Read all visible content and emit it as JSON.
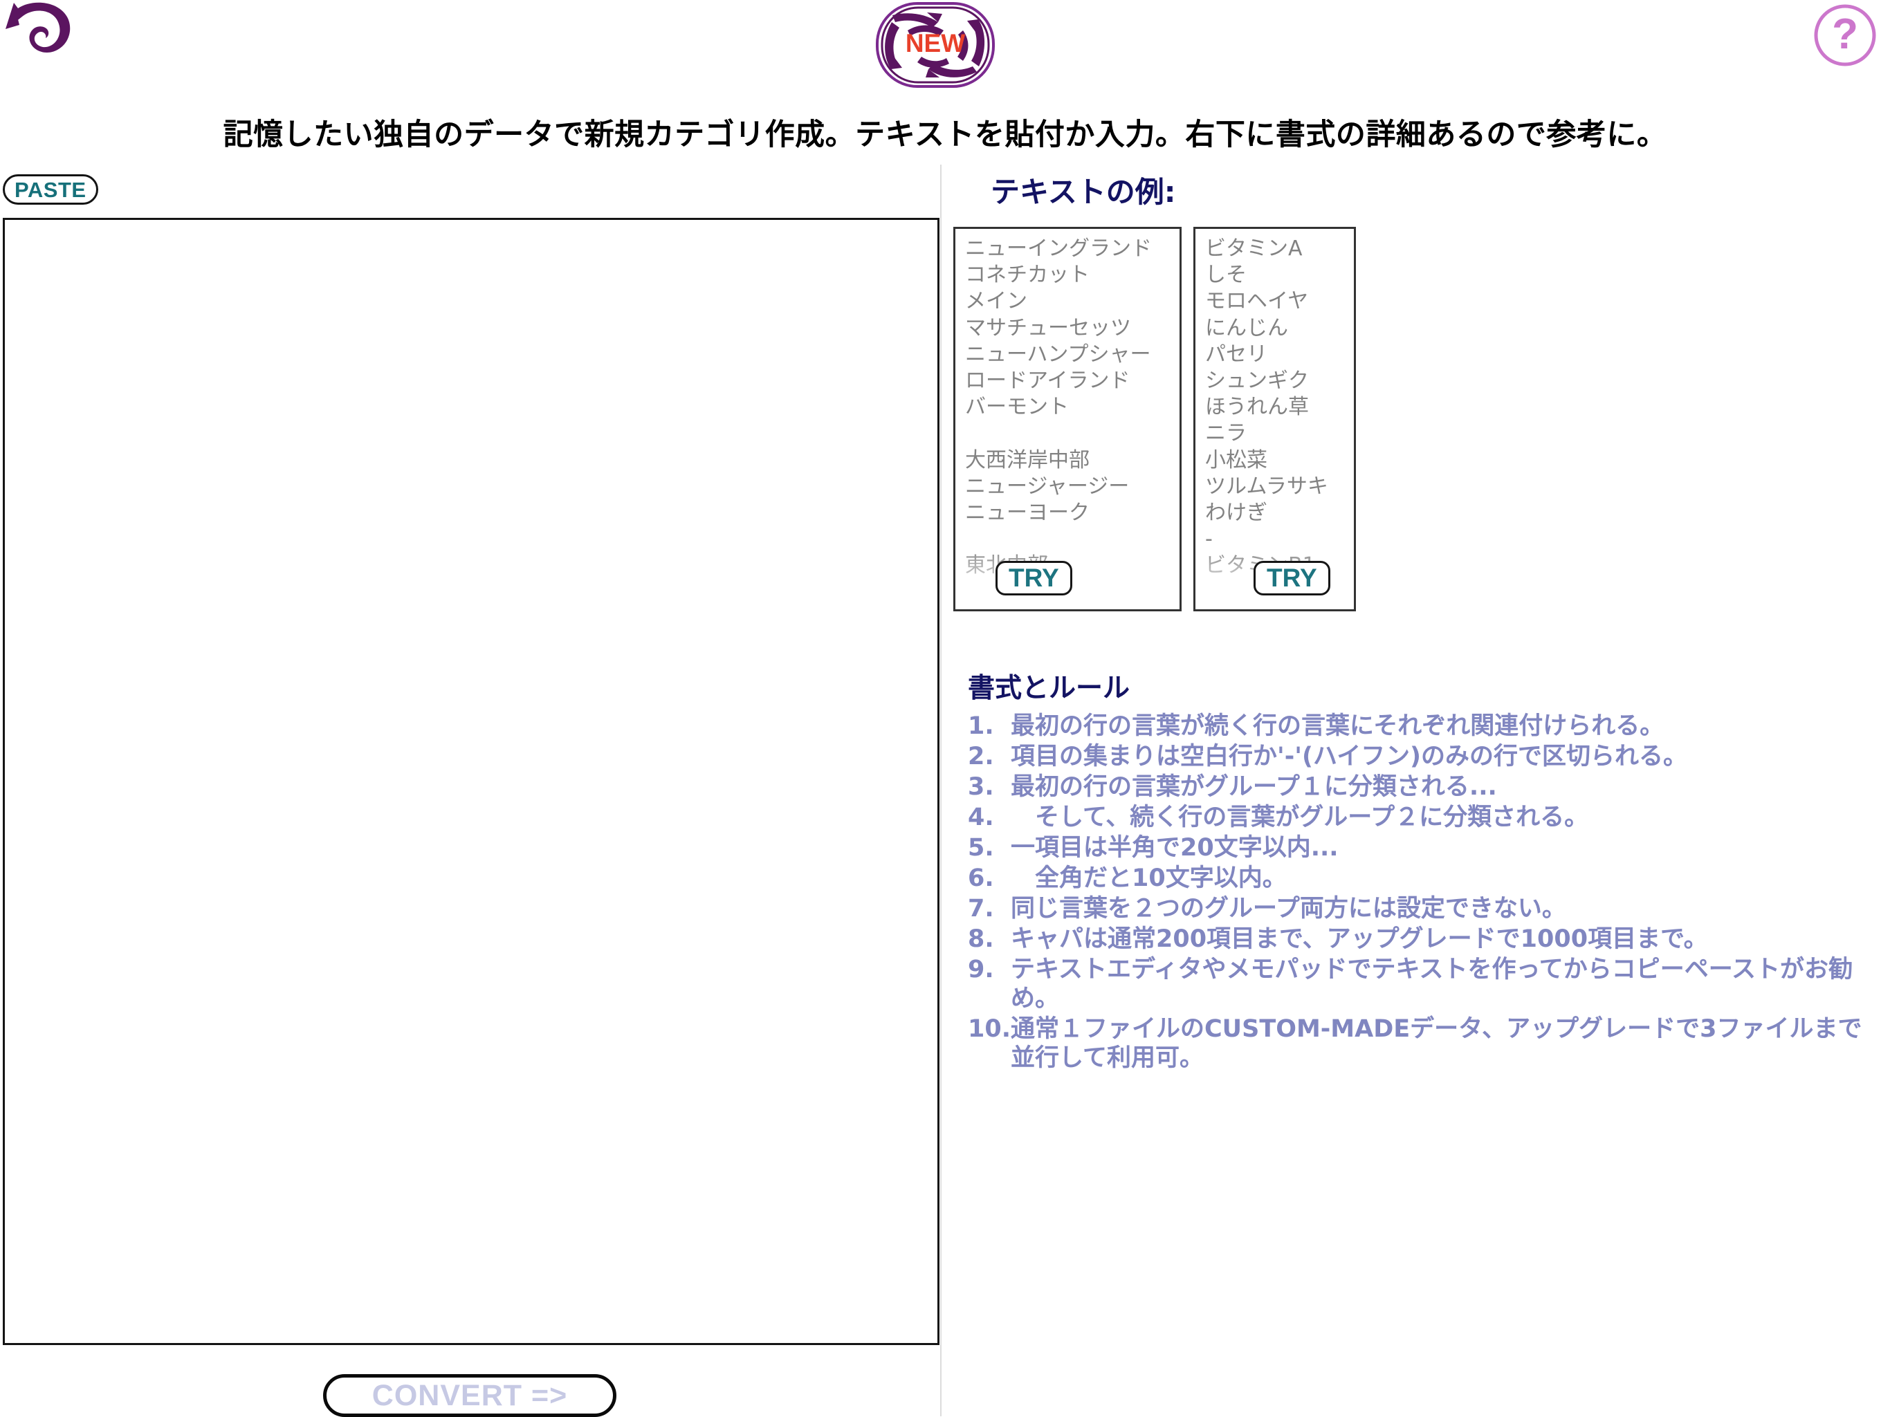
{
  "top_bar": {
    "back_icon": "back-arrow-icon",
    "logo": {
      "icon": "refresh-swirl-icon",
      "text": "NEW",
      "color": "#e8402a",
      "ring_color": "#5b1560"
    },
    "help": {
      "icon": "question-mark-icon",
      "label": "?",
      "color": "#cc77cc"
    }
  },
  "headline": "記憶したい独自のデータで新規カテゴリ作成。テキストを貼付か入力。右下に書式の詳細あるので参考に。",
  "left_pane": {
    "paste_button_label": "PASTE",
    "textarea_value": "",
    "textarea_placeholder": "",
    "convert_button_label": "CONVERT =>"
  },
  "right_pane": {
    "examples_heading": "テキストの例:",
    "examples": [
      {
        "try_label": "TRY",
        "lines": [
          "ニューイングランド",
          "コネチカット",
          "メイン",
          "マサチューセッツ",
          "ニューハンプシャー",
          "ロードアイランド",
          "バーモント",
          "",
          "大西洋岸中部",
          "ニュージャージー",
          "ニューヨーク",
          "",
          "東北中部"
        ]
      },
      {
        "try_label": "TRY",
        "lines": [
          "ビタミンA",
          "しそ",
          "モロヘイヤ",
          "にんじん",
          "パセリ",
          "シュンギク",
          "ほうれん草",
          "ニラ",
          "小松菜",
          "ツルムラサキ",
          "わけぎ",
          "-",
          "ビタミンB1"
        ]
      }
    ],
    "rules_heading": "書式とルール",
    "rules": [
      "最初の行の言葉が続く行の言葉にそれぞれ関連付けられる。",
      "項目の集まりは空白行か'-'(ハイフン)のみの行で区切られる。",
      "最初の行の言葉がグループ１に分類される...",
      "　そして、続く行の言葉がグループ２に分類される。",
      "一項目は半角で20文字以内...",
      "　全角だと10文字以内。",
      "同じ言葉を２つのグループ両方には設定できない。",
      "キャパは通常200項目まで、アップグレードで1000項目まで。",
      "テキストエディタやメモパッドでテキストを作ってからコピーペーストがお勧め。",
      "通常１ファイルのCUSTOM-MADEデータ、アップグレードで3ファイルまで並行して利用可。"
    ]
  },
  "colors": {
    "accent_navy": "#131363",
    "rule_text": "#8086c0",
    "teal": "#1d7480",
    "example_text": "#828282",
    "logo_purple": "#5b1560",
    "help_orchid": "#cc77cc",
    "convert_label": "#c6c9e4"
  }
}
